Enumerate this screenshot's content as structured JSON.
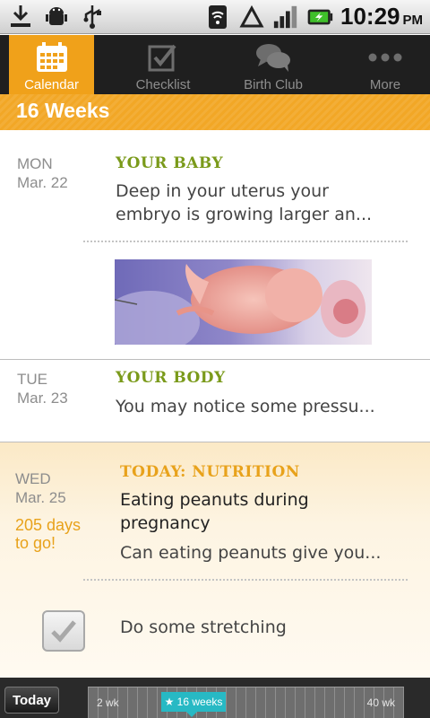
{
  "status_bar": {
    "time": "10:29",
    "ampm": "PM",
    "left_icons": [
      "download-icon",
      "android-debug-icon",
      "usb-icon"
    ],
    "right_icons": [
      "wifi-icon",
      "triangle-signal-icon",
      "cell-signal-icon",
      "battery-charging-icon"
    ]
  },
  "tabs": [
    {
      "label": "Calendar",
      "icon": "calendar-icon",
      "active": true
    },
    {
      "label": "Checklist",
      "icon": "checklist-icon",
      "active": false
    },
    {
      "label": "Birth Club",
      "icon": "chat-bubbles-icon",
      "active": false
    },
    {
      "label": "More",
      "icon": "more-dots-icon",
      "active": false
    }
  ],
  "week_header": "16 Weeks",
  "entries": [
    {
      "day": "MON",
      "date": "Mar. 22",
      "title": "YOUR BABY",
      "text": "Deep in your uterus your embryo is growing larger an..."
    },
    {
      "day": "TUE",
      "date": "Mar. 23",
      "title": "YOUR BODY",
      "text": "You may notice some pressu..."
    },
    {
      "day": "WED",
      "date": "Mar. 25",
      "days_left": "205 days to go!",
      "title": "TODAY: NUTRITION",
      "headline": "Eating peanuts during pregnancy",
      "text": "Can eating peanuts give you..."
    }
  ],
  "task": {
    "label": "Do some stretching",
    "checked": true
  },
  "bottom_bar": {
    "today_button": "Today",
    "start_label": "2 wk",
    "current_label": "★ 16 weeks",
    "end_label": "40 wk"
  },
  "colors": {
    "accent": "#f0a11a",
    "green_title": "#7a9a1a",
    "orange_title": "#e8a21b",
    "timeline_marker": "#27b9c4"
  }
}
